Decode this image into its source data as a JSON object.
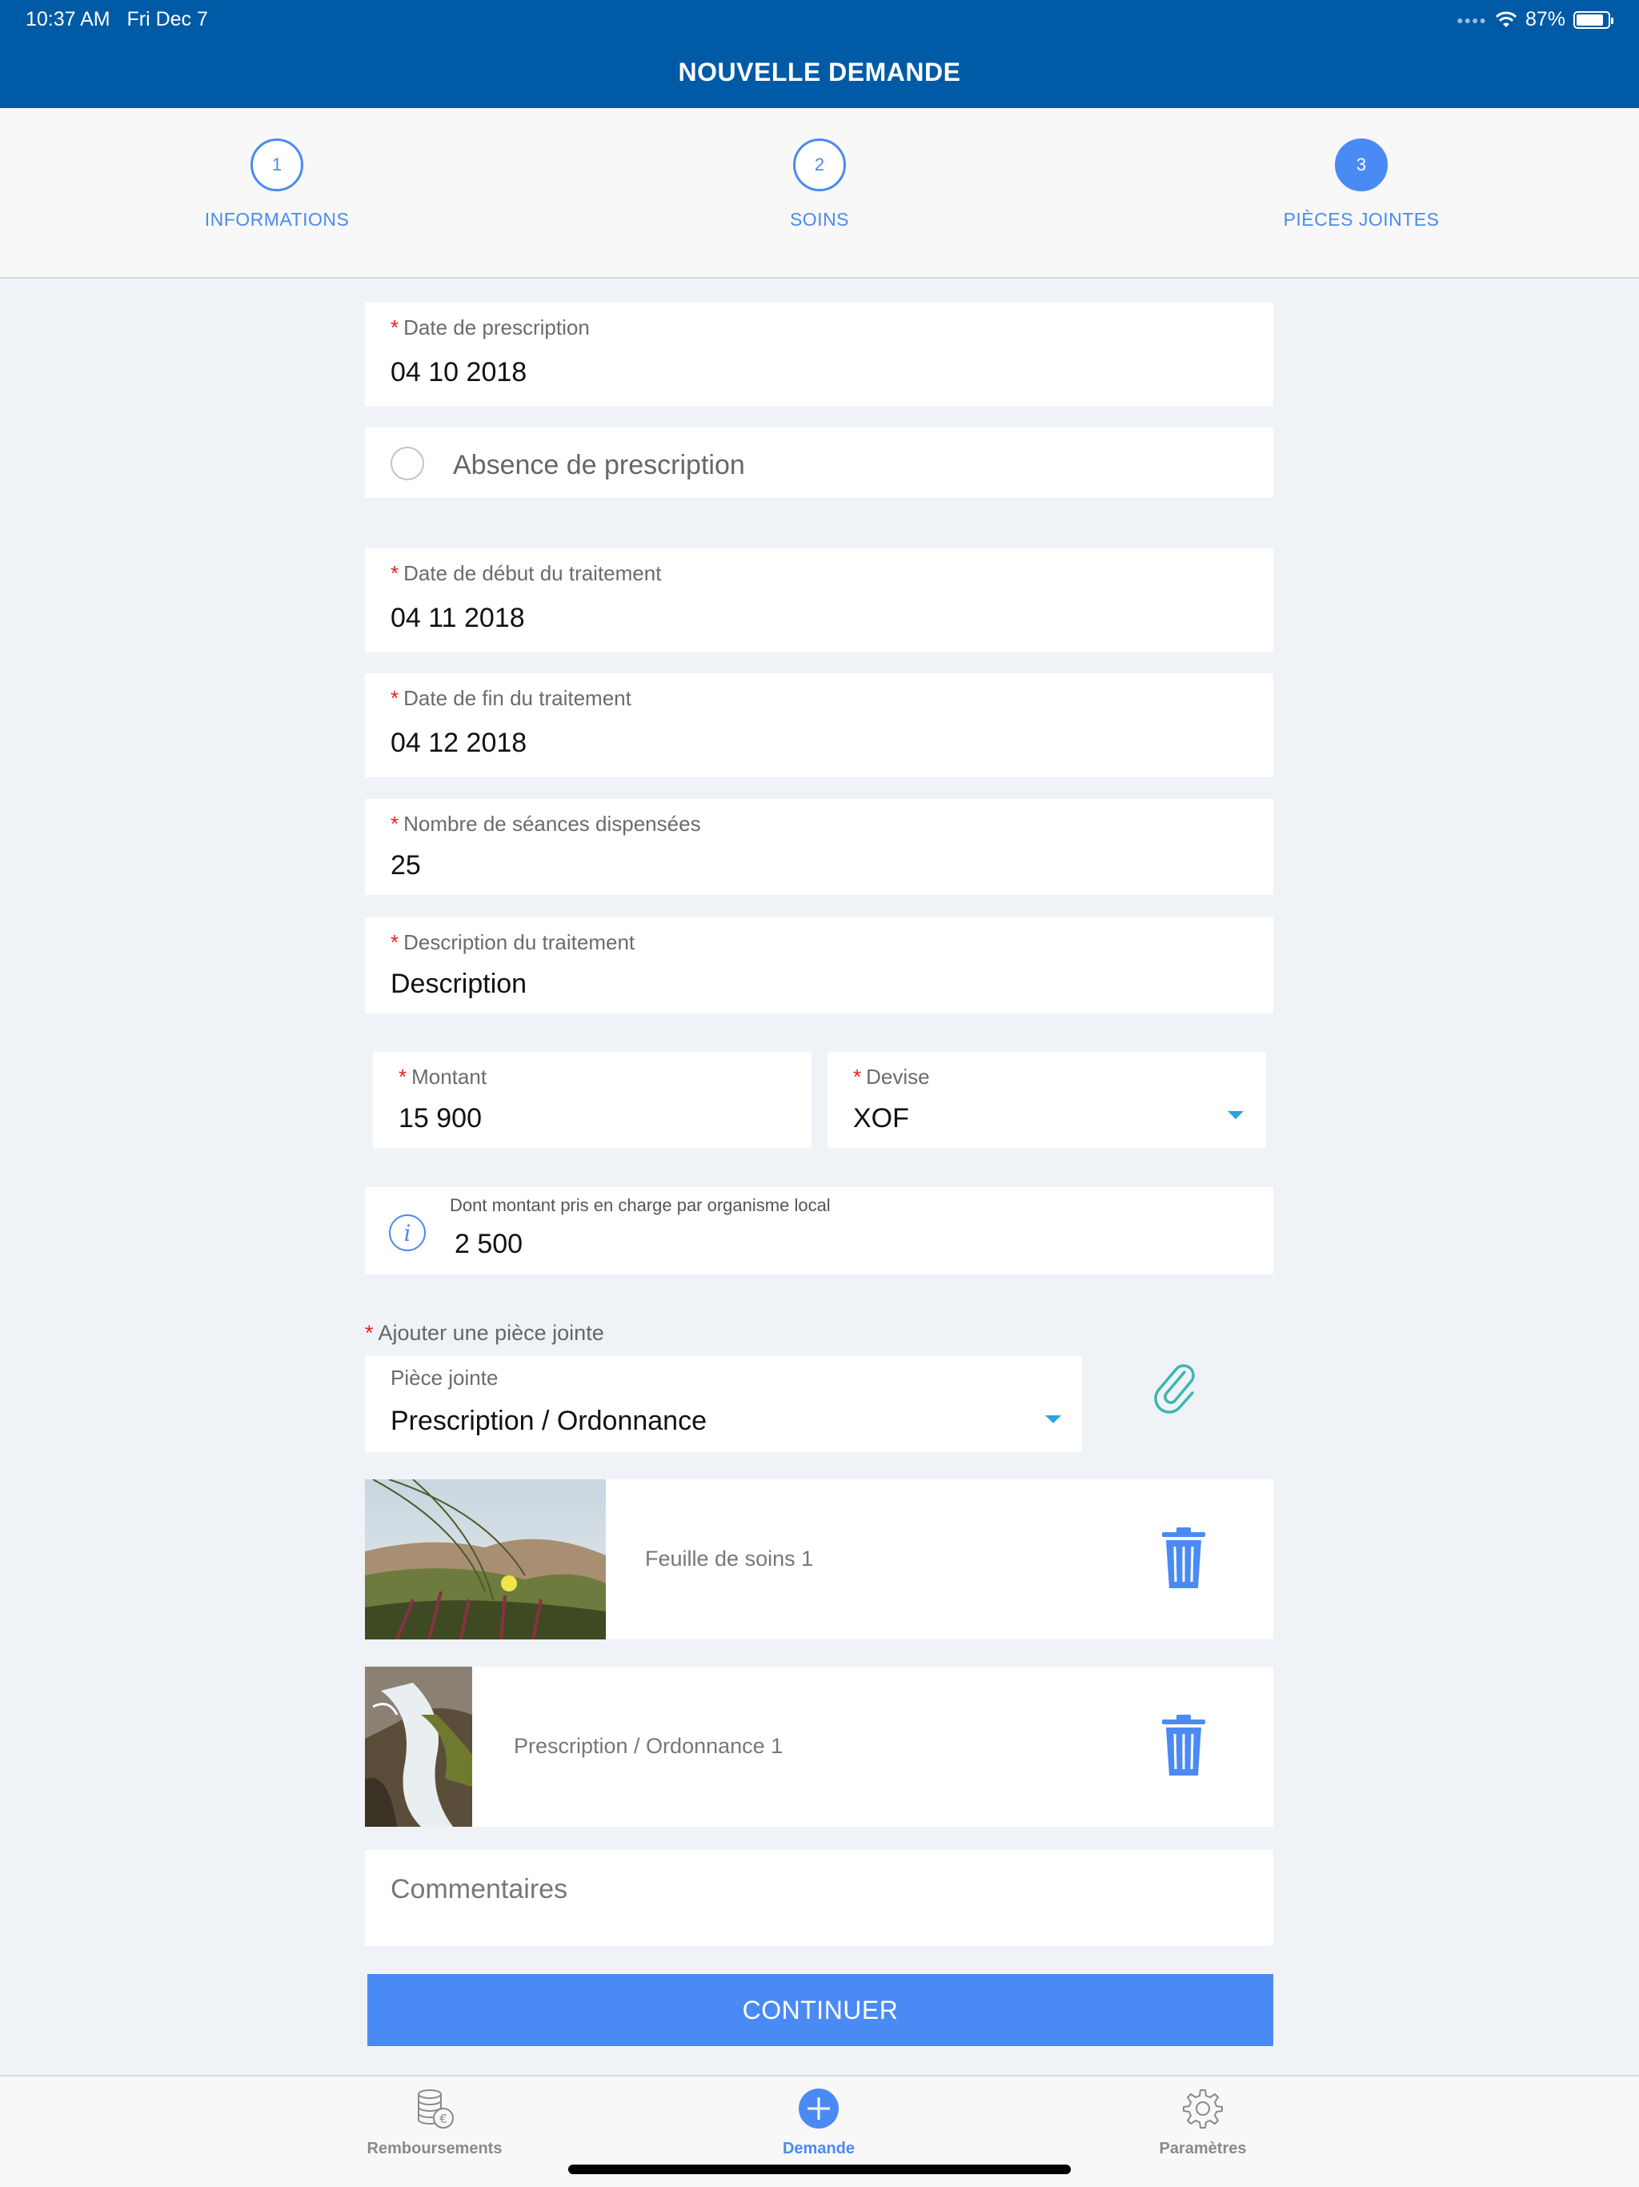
{
  "status_bar": {
    "time": "10:37 AM",
    "date": "Fri Dec 7",
    "battery": "87%",
    "battery_level": 0.87
  },
  "header": {
    "title": "NOUVELLE DEMANDE"
  },
  "steps": [
    {
      "number": "1",
      "label": "INFORMATIONS",
      "active": false
    },
    {
      "number": "2",
      "label": "SOINS",
      "active": false
    },
    {
      "number": "3",
      "label": "PIÈCES JOINTES",
      "active": true
    }
  ],
  "form": {
    "required_mark": "*",
    "prescription_date": {
      "label": "Date de prescription",
      "value": "04 10 2018"
    },
    "no_prescription": {
      "label": "Absence de prescription",
      "checked": false
    },
    "treatment_start": {
      "label": "Date de début du traitement",
      "value": "04 11 2018"
    },
    "treatment_end": {
      "label": "Date de fin du traitement",
      "value": "04 12 2018"
    },
    "sessions": {
      "label": "Nombre de séances dispensées",
      "value": "25"
    },
    "description": {
      "label": "Description du traitement",
      "value": "Description"
    },
    "amount": {
      "label": "Montant",
      "value": "15 900"
    },
    "currency": {
      "label": "Devise",
      "value": "XOF"
    },
    "local_amount": {
      "label": "Dont montant pris en charge par organisme local",
      "value": "2 500",
      "icon": "info-icon"
    },
    "attachment_section": {
      "label": "Ajouter une pièce jointe"
    },
    "attachment_type": {
      "label": "Pièce jointe",
      "value": "Prescription / Ordonnance"
    },
    "attachments": [
      {
        "name": "Feuille de soins 1",
        "icon": "trash-icon"
      },
      {
        "name": "Prescription / Ordonnance 1",
        "icon": "trash-icon"
      }
    ],
    "comments": {
      "placeholder": "Commentaires"
    }
  },
  "continue_button": {
    "label": "CONTINUER"
  },
  "tabbar": [
    {
      "label": "Remboursements",
      "icon": "coins-euro-icon",
      "active": false
    },
    {
      "label": "Demande",
      "icon": "plus-circle-icon",
      "active": true
    },
    {
      "label": "Paramètres",
      "icon": "gear-icon",
      "active": false
    }
  ],
  "colors": {
    "header": "#005aa5",
    "accent": "#4a8af4",
    "required": "#e2231a",
    "dropdown": "#29a3dc"
  }
}
